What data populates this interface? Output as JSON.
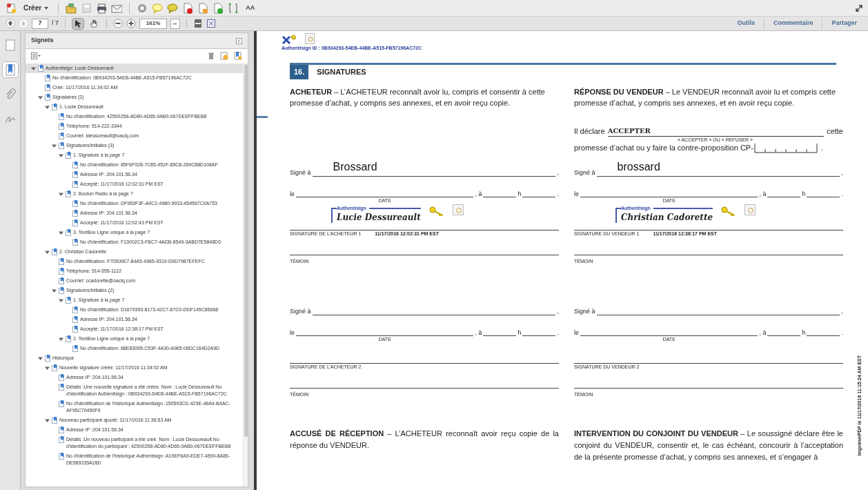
{
  "toolbar": {
    "create_label": "Créer",
    "text_tool": "AA",
    "nav": [
      {
        "kind": "up",
        "disabled": false
      },
      {
        "kind": "down",
        "disabled": true
      }
    ],
    "page_number": "7",
    "page_total": "/ 7",
    "tools": [
      {
        "kind": "select",
        "selected": true
      },
      {
        "kind": "hand",
        "selected": false
      }
    ],
    "zoom": "161%",
    "right_tabs": [
      "Outils",
      "Commentaire",
      "Partager"
    ]
  },
  "side_tabs": [
    {
      "kind": "pages",
      "selected": false
    },
    {
      "kind": "bookmarks",
      "selected": true
    },
    {
      "kind": "attachments",
      "selected": false
    },
    {
      "kind": "signatures",
      "selected": false
    }
  ],
  "bookmarks_panel": {
    "title": "Signets",
    "tree": [
      {
        "label": "Authentisign: Lucie Dessureault",
        "selected": true,
        "expanded": true,
        "children": [
          {
            "label": "No d'identification: 0B934293-54EB-44BE-A515-FB57196AC72C",
            "selected": false
          },
          {
            "label": "Créé: 11/17/2016 11:34:02 AM",
            "selected": false
          },
          {
            "label": "Signataires (2)",
            "selected": false,
            "expanded": true,
            "children": [
              {
                "label": "1. Lucie Dessureault",
                "selected": false,
                "expanded": true,
                "children": [
                  {
                    "label": "No d'identification: 42500258-AD80-4D65-9AB0-067DEEFFBEB8",
                    "selected": false
                  },
                  {
                    "label": "Téléphone: 514-222-3344",
                    "selected": false
                  },
                  {
                    "label": "Courriel: ldessureault@oaciq.com",
                    "selected": false
                  },
                  {
                    "label": "Signatures/initiales (3)",
                    "selected": false,
                    "expanded": true,
                    "children": [
                      {
                        "label": "1. Signature à la page 7",
                        "selected": false,
                        "expanded": true,
                        "children": [
                          {
                            "label": "No d'identification: 85F6F028-7C85-451F-85C8-269C88D108AF",
                            "selected": false
                          },
                          {
                            "label": "Adresse IP: 204.101.56.34",
                            "selected": false
                          },
                          {
                            "label": "Accepté: 11/17/2016 12:02:31 PM EST",
                            "selected": false
                          }
                        ]
                      },
                      {
                        "label": "2. Bouton Radio à la page 7",
                        "selected": false,
                        "expanded": true,
                        "children": [
                          {
                            "label": "No d'identification: DF953F3F-A0C2-4980-9933-454567C0A753",
                            "selected": false
                          },
                          {
                            "label": "Adresse IP: 204.101.56.34",
                            "selected": false
                          },
                          {
                            "label": "Accepté: 11/17/2016 12:02:43 PM EST",
                            "selected": false
                          }
                        ]
                      },
                      {
                        "label": "3. TextBox Ligne unique à la page 7",
                        "selected": false,
                        "expanded": true,
                        "children": [
                          {
                            "label": "No d'identification: F13002C3-FBC7-4ADB-8549-3ABD7E5848D0",
                            "selected": false
                          }
                        ]
                      }
                    ]
                  }
                ]
              },
              {
                "label": "2. Christian Cadorette",
                "selected": false,
                "expanded": true,
                "children": [
                  {
                    "label": "No d'identification: F70500E7-84A5-4965-9319-D9D7987EFEFC",
                    "selected": false
                  },
                  {
                    "label": "Téléphone: 514-555-1122",
                    "selected": false
                  },
                  {
                    "label": "Courriel: ccadorette@oaciq.com",
                    "selected": false
                  },
                  {
                    "label": "Signatures/initiales (2)",
                    "selected": false,
                    "expanded": true,
                    "children": [
                      {
                        "label": "1. Signature à la page 7",
                        "selected": false,
                        "expanded": true,
                        "children": [
                          {
                            "label": "No d'identification: D1679393-8173-42C7-87C0-DDF145C85668",
                            "selected": false
                          },
                          {
                            "label": "Adresse IP: 204.101.56.34",
                            "selected": false
                          },
                          {
                            "label": "Accepté: 11/17/2016 12:38:17 PM EST",
                            "selected": false
                          }
                        ]
                      },
                      {
                        "label": "2. TextBox Ligne unique à la page 7",
                        "selected": false,
                        "expanded": true,
                        "children": [
                          {
                            "label": "No d'identification: 68E83095-C53F-4A30-A965-06DC164D2A9D",
                            "selected": false
                          }
                        ]
                      }
                    ]
                  }
                ]
              }
            ]
          },
          {
            "label": "Historique",
            "selected": false,
            "expanded": true,
            "children": [
              {
                "label": "Nouvelle signature créée: 11/17/2016 11:34:02 AM",
                "selected": false,
                "expanded": true,
                "children": [
                  {
                    "label": "Adresse IP :204.101.56.34",
                    "selected": false
                  },
                  {
                    "label": "Détails :Une nouvelle signature a été créée. Nom : Lucie Dessureault No d'identification Authentisign : 0B934293-54EB-44BE-A515-FB57196AC72C",
                    "selected": false
                  },
                  {
                    "label": "No d'identification de l'historique Authentisign :150593CD-429E-48A4-B4AC-AF95C70450F9",
                    "selected": false
                  }
                ]
              },
              {
                "label": "Nouveau participant ajouté: 11/17/2016 11:36:53 AM",
                "selected": false,
                "expanded": true,
                "children": [
                  {
                    "label": "Adresse IP :204.101.56.34",
                    "selected": false
                  },
                  {
                    "label": "Détails :Un nouveau participant a été créé. Nom : Lucie Dessureault No d'identification du participant : 42500258-AD80-4D65-9AB0-067DEEFFBEB8",
                    "selected": false
                  },
                  {
                    "label": "No d'identification de l'historique Authentisign :A19EF6A9-EDE7-4590-8A85-DE589235A28D",
                    "selected": false
                  }
                ]
              }
            ]
          }
        ]
      }
    ]
  },
  "document": {
    "auth_id": "Authentisign ID : 0B934293-54EB-44BE-A515-FB57196AC72C",
    "section": {
      "number": "16.",
      "title": "SIGNATURES"
    },
    "intro": [
      "**ACHETEUR** – L’ACHETEUR reconnaît avoir lu, compris et consentir à cette promesse d’achat, y compris ses annexes, et en avoir reçu copie.",
      "**RÉPONSE DU VENDEUR** – Le VENDEUR reconnaît avoir lu et compris cette promesse d’achat, y compris ses annexes, et en avoir reçu copie."
    ],
    "declaration": {
      "prefix": "Il déclare",
      "value": "ACCEPTER",
      "hint": "« ACCEPTER » OU « REFUSER »",
      "suffix": "cette",
      "line2": "promesse d’achat ou y faire la contre-proposition CP-",
      "end": "."
    },
    "signature_rows": [
      [
        {
          "signed_at": "Signé à",
          "place": "Brossard",
          "comma": ",",
          "on": "le",
          "date_label": "DATE",
          "at": ", à",
          "hour": "h",
          "end": ".",
          "stamp": {
            "brand": "Authentisign",
            "name": "Lucie Dessureault",
            "timestamp": "11/17/2016 12:02:31 PM EST"
          },
          "signature_label": "SIGNATURE DE L’ACHETEUR 1",
          "witness_label": "TÉMOIN"
        },
        {
          "signed_at": "Signé à",
          "place": "brossard",
          "comma": ",",
          "on": "le",
          "date_label": "DATE",
          "at": ", à",
          "hour": "h",
          "end": ".",
          "stamp": {
            "brand": "Authentisign",
            "name": "Christian Cadorette",
            "timestamp": "11/17/2016 12:38:17 PM EST"
          },
          "signature_label": "SIGNATURE DU VENDEUR 1",
          "witness_label": "TÉMOIN"
        }
      ],
      [
        {
          "signed_at": "Signé à",
          "comma": ",",
          "on": "le",
          "date_label": "DATE",
          "at": ", à",
          "hour": "h",
          "end": ".",
          "signature_label": "SIGNATURE DE L’ACHETEUR 2",
          "witness_label": "TÉMOIN"
        },
        {
          "signed_at": "Signé à",
          "comma": ",",
          "on": "le",
          "date_label": "DATE",
          "at": ", à",
          "hour": "h",
          "end": ".",
          "signature_label": "SIGNATURE DU VENDEUR 2",
          "witness_label": "TÉMOIN"
        }
      ]
    ],
    "closing": [
      "**ACCUSÉ DE RÉCEPTION** – L’ACHETEUR reconnaît avoir reçu copie de la réponse du VENDEUR.",
      "**INTERVENTION DU CONJOINT DU VENDEUR** – Le soussigné déclare être le conjoint du VENDEUR, consentir et, le cas échéant, concourir à l’acceptation de la présente promesse d’achat, y compris ses annexes, et s’engager à"
    ],
    "side_note": "Imprimé/PDF le 11/17/2016 11:15:24 AM EST"
  }
}
